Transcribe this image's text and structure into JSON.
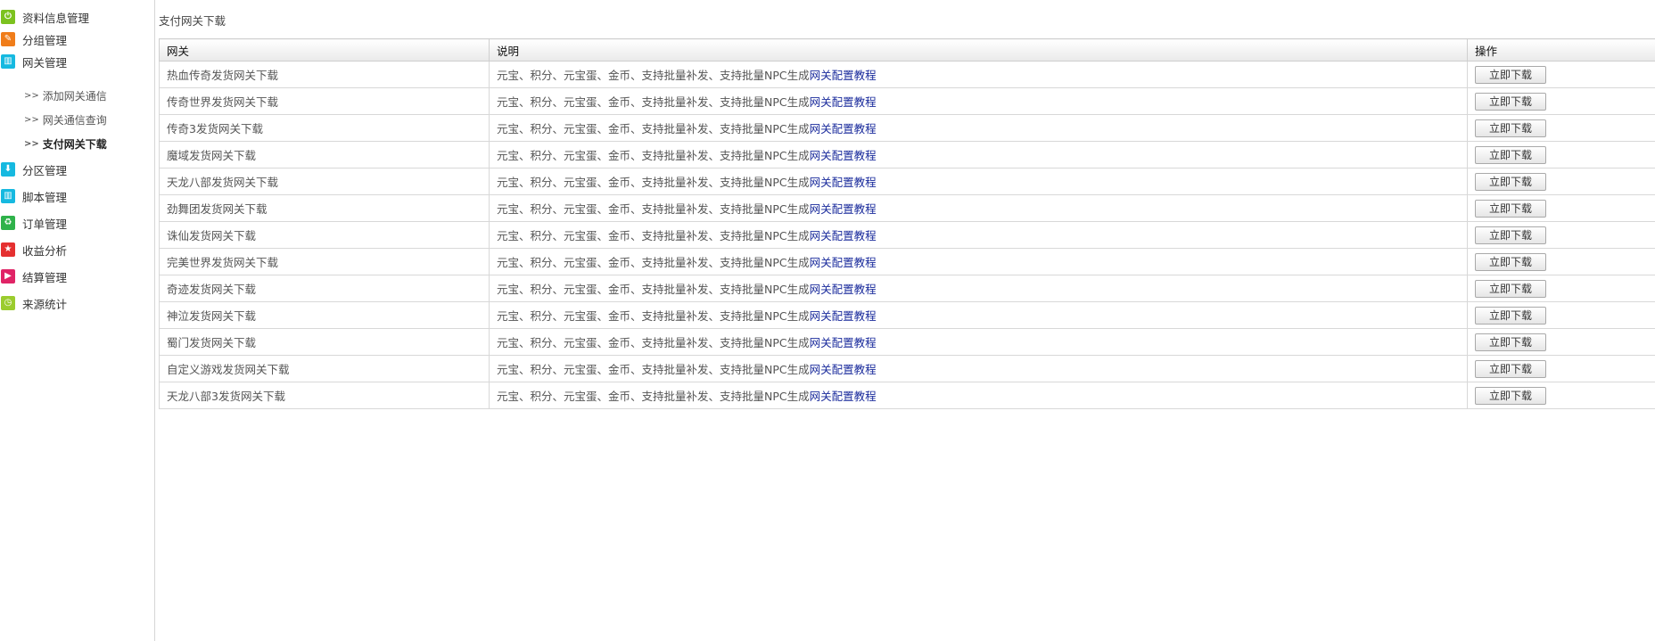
{
  "colors": {
    "icon_green": "#7cc21f",
    "icon_orange": "#f07d1a",
    "icon_cyan": "#16b9e0",
    "icon_red": "#e53030",
    "icon_pink": "#e02466",
    "icon_lime": "#9bcc2e",
    "link_blue": "#1a2b9c"
  },
  "sidebar": {
    "items": [
      {
        "label": "资料信息管理",
        "icon": "power-icon"
      },
      {
        "label": "分组管理",
        "icon": "pencil-icon"
      },
      {
        "label": "网关管理",
        "icon": "grid-icon"
      },
      {
        "label": "分区管理",
        "icon": "arrow-down-icon"
      },
      {
        "label": "脚本管理",
        "icon": "grid-icon"
      },
      {
        "label": "订单管理",
        "icon": "recycle-icon"
      },
      {
        "label": "收益分析",
        "icon": "star-icon"
      },
      {
        "label": "结算管理",
        "icon": "play-icon"
      },
      {
        "label": "来源统计",
        "icon": "clock-icon"
      }
    ],
    "sub_items": [
      {
        "arrow": ">>",
        "label": "添加网关通信"
      },
      {
        "arrow": ">>",
        "label": "网关通信查询"
      },
      {
        "arrow": ">>",
        "label": "支付网关下载"
      }
    ]
  },
  "page_title": "支付网关下载",
  "table": {
    "headers": [
      "网关",
      "说明",
      "操作"
    ],
    "desc_text": "元宝、积分、元宝蛋、金币、支持批量补发、支持批量NPC生成",
    "desc_link": "网关配置教程",
    "button_label": "立即下载",
    "rows": [
      "热血传奇发货网关下载",
      "传奇世界发货网关下载",
      "传奇3发货网关下载",
      "魔域发货网关下载",
      "天龙八部发货网关下载",
      "劲舞团发货网关下载",
      "诛仙发货网关下载",
      "完美世界发货网关下载",
      "奇迹发货网关下载",
      "神泣发货网关下载",
      "蜀门发货网关下载",
      "自定义游戏发货网关下载",
      "天龙八部3发货网关下载"
    ]
  }
}
